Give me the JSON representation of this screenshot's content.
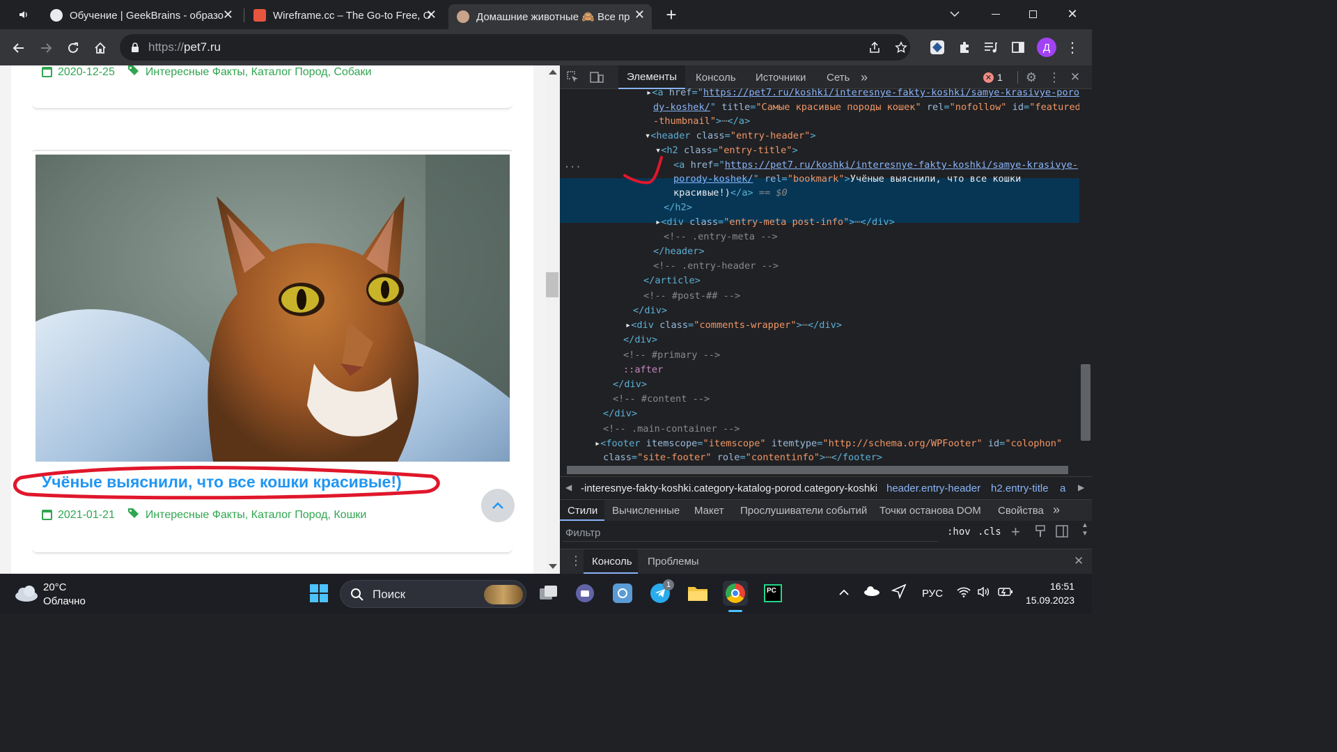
{
  "browser": {
    "tabs": [
      {
        "title": "Обучение | GeekBrains - образо",
        "active": false
      },
      {
        "title": "Wireframe.cc – The Go-to Free, O",
        "active": false
      },
      {
        "title": "Домашние животные 🙈 Все пр",
        "active": true
      }
    ],
    "new_tab_label": "+",
    "url_scheme": "https://",
    "url_host": "pet7.ru"
  },
  "page": {
    "post1": {
      "date": "2020-12-25",
      "categories": "Интересные Факты, Каталог Пород, Собаки"
    },
    "post2": {
      "title": "Учёные выяснили, что все кошки красивые!)",
      "date": "2021-01-21",
      "categories": "Интересные Факты, Каталог Пород, Кошки"
    }
  },
  "devtools": {
    "tabs": [
      "Элементы",
      "Консоль",
      "Источники",
      "Сеть"
    ],
    "error_count": "1",
    "code": {
      "l1_href": "https://pet7.ru/koshki/interesnye-fakty-koshki/samye-krasivye-poro",
      "l2_href": "dy-koshek/",
      "l2_title": "\"Самые красивые породы кошек\"",
      "l2_rel": "\"nofollow\"",
      "l2_id": "\"featured",
      "l3_id": "-thumbnail\"",
      "sel_href1": "https://pet7.ru/koshki/interesnye-fakty-koshki/samye-krasivye-",
      "sel_href2": "porody-koshek/",
      "sel_text1": "Учёные выяснили, что все кошки",
      "sel_text2": "красивые!)",
      "sel_eq": "== $0",
      "div_class": "\"entry-meta post-info\"",
      "c_entry_meta": "<!-- .entry-meta -->",
      "c_entry_header": "<!-- .entry-header -->",
      "c_post": "<!-- #post-## -->",
      "comments_class": "\"comments-wrapper\"",
      "c_primary": "<!-- #primary -->",
      "after": "::after",
      "c_content": "<!-- #content -->",
      "c_main": "<!-- .main-container -->",
      "footer_itemscope": "\"itemscope\"",
      "footer_itemtype": "\"http://schema.org/WPFooter\"",
      "footer_id": "\"colophon\"",
      "footer_class": "\"site-footer\"",
      "footer_role": "\"contentinfo\""
    },
    "breadcrumbs": [
      "-interesnye-fakty-koshki.category-katalog-porod.category-koshki",
      "header.entry-header",
      "h2.entry-title",
      "a"
    ],
    "lower_tabs": [
      "Стили",
      "Вычисленные",
      "Макет",
      "Прослушиватели событий",
      "Точки останова DOM",
      "Свойства"
    ],
    "filter_placeholder": "Фильтр",
    "hov": ":hov",
    "cls": ".cls",
    "drawer_tabs": [
      "Консоль",
      "Проблемы"
    ]
  },
  "taskbar": {
    "weather_temp": "20°C",
    "weather_desc": "Облачно",
    "search_label": "Поиск",
    "lang": "РУС",
    "time": "16:51",
    "date": "15.09.2023",
    "telegram_badge": "1"
  },
  "colors": {
    "accent_link": "#2196f3",
    "meta_green": "#2fa64f",
    "annotation_red": "#e0172b",
    "devtools_selection": "#073655"
  }
}
